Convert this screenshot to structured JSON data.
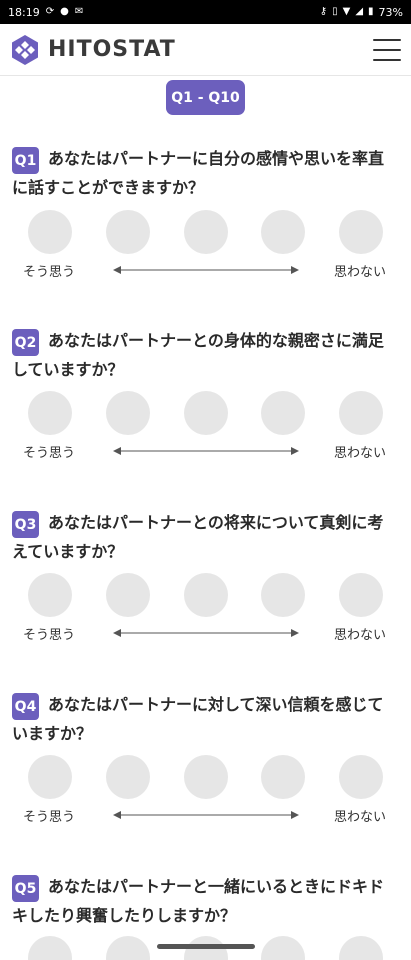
{
  "status_bar": {
    "time": "18:19",
    "battery": "73%"
  },
  "header": {
    "brand": "HITOSTAT"
  },
  "range_label": "Q1 - Q10",
  "scale": {
    "left": "そう思う",
    "right": "思わない"
  },
  "questions": [
    {
      "num": "Q1",
      "text": "あなたはパートナーに自分の感情や思いを率直に話すことができますか？"
    },
    {
      "num": "Q2",
      "text": "あなたはパートナーとの身体的な親密さに満足していますか？"
    },
    {
      "num": "Q3",
      "text": "あなたはパートナーとの将来について真剣に考えていますか？"
    },
    {
      "num": "Q4",
      "text": "あなたはパートナーに対して深い信頼を感じていますか？"
    },
    {
      "num": "Q5",
      "text": "あなたはパートナーと一緒にいるときにドキドキしたり興奮したりしますか？"
    }
  ],
  "colors": {
    "accent": "#6c5fbd",
    "choice": "#e6e6e6"
  }
}
